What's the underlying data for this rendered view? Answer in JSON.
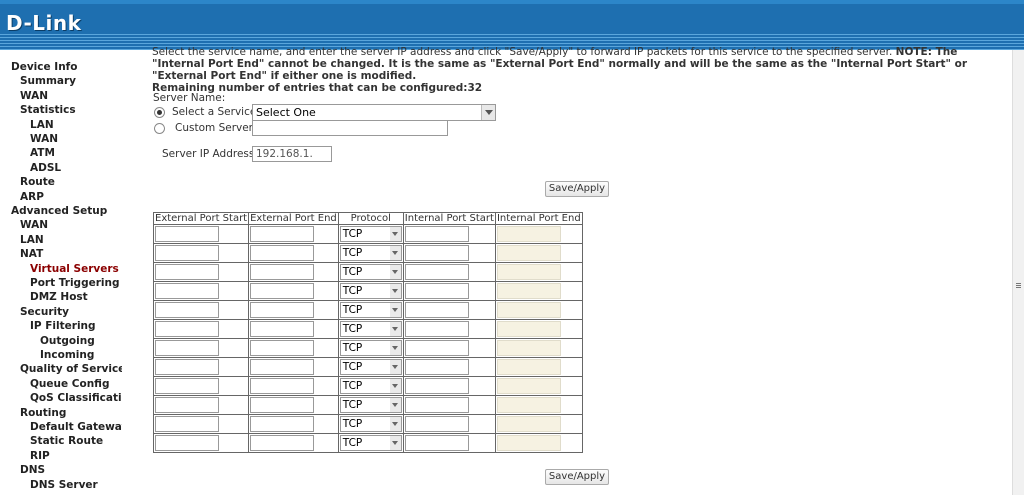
{
  "header": {
    "logo_text": "D-Link",
    "brand_color": "#1e6fb0"
  },
  "sidebar": {
    "items": [
      {
        "label": "Device Info",
        "level": 0,
        "top": true
      },
      {
        "label": "Summary",
        "level": 1
      },
      {
        "label": "WAN",
        "level": 1
      },
      {
        "label": "Statistics",
        "level": 1
      },
      {
        "label": "LAN",
        "level": 2
      },
      {
        "label": "WAN",
        "level": 2
      },
      {
        "label": "ATM",
        "level": 2
      },
      {
        "label": "ADSL",
        "level": 2
      },
      {
        "label": "Route",
        "level": 1
      },
      {
        "label": "ARP",
        "level": 1
      },
      {
        "label": "Advanced Setup",
        "level": 0,
        "top": true
      },
      {
        "label": "WAN",
        "level": 1
      },
      {
        "label": "LAN",
        "level": 1
      },
      {
        "label": "NAT",
        "level": 1
      },
      {
        "label": "Virtual Servers",
        "level": 2,
        "active": true
      },
      {
        "label": "Port Triggering",
        "level": 2
      },
      {
        "label": "DMZ Host",
        "level": 2
      },
      {
        "label": "Security",
        "level": 1
      },
      {
        "label": "IP Filtering",
        "level": 2
      },
      {
        "label": "Outgoing",
        "level": 3
      },
      {
        "label": "Incoming",
        "level": 3
      },
      {
        "label": "Quality of Service",
        "level": 1
      },
      {
        "label": "Queue Config",
        "level": 2
      },
      {
        "label": "QoS Classification",
        "level": 2
      },
      {
        "label": "Routing",
        "level": 1
      },
      {
        "label": "Default Gateway",
        "level": 2
      },
      {
        "label": "Static Route",
        "level": 2
      },
      {
        "label": "RIP",
        "level": 2
      },
      {
        "label": "DNS",
        "level": 1
      },
      {
        "label": "DNS Server",
        "level": 2
      }
    ]
  },
  "main": {
    "intro_line1": "Select the service name, and enter the server IP address and click \"Save/Apply\" to forward IP packets for this service to the specified server.",
    "intro_note": "NOTE: The \"Internal Port End\" cannot be changed. It is the same as \"External Port End\" normally and will be the same as the \"Internal Port Start\" or \"External Port End\" if either one is modified.",
    "remaining": "Remaining number of entries that can be configured:32",
    "server_name_label": "Server Name:",
    "select_service_label": "Select a Service:",
    "select_service_value": "Select One",
    "custom_server_label": "Custom Server:",
    "custom_server_value": "",
    "server_ip_label": "Server IP Address:",
    "server_ip_value": "192.168.1.",
    "save_apply": "Save/Apply"
  },
  "table": {
    "headers": [
      "External Port Start",
      "External Port End",
      "Protocol",
      "Internal Port Start",
      "Internal Port End"
    ],
    "protocol_default": "TCP",
    "row_count": 12
  }
}
